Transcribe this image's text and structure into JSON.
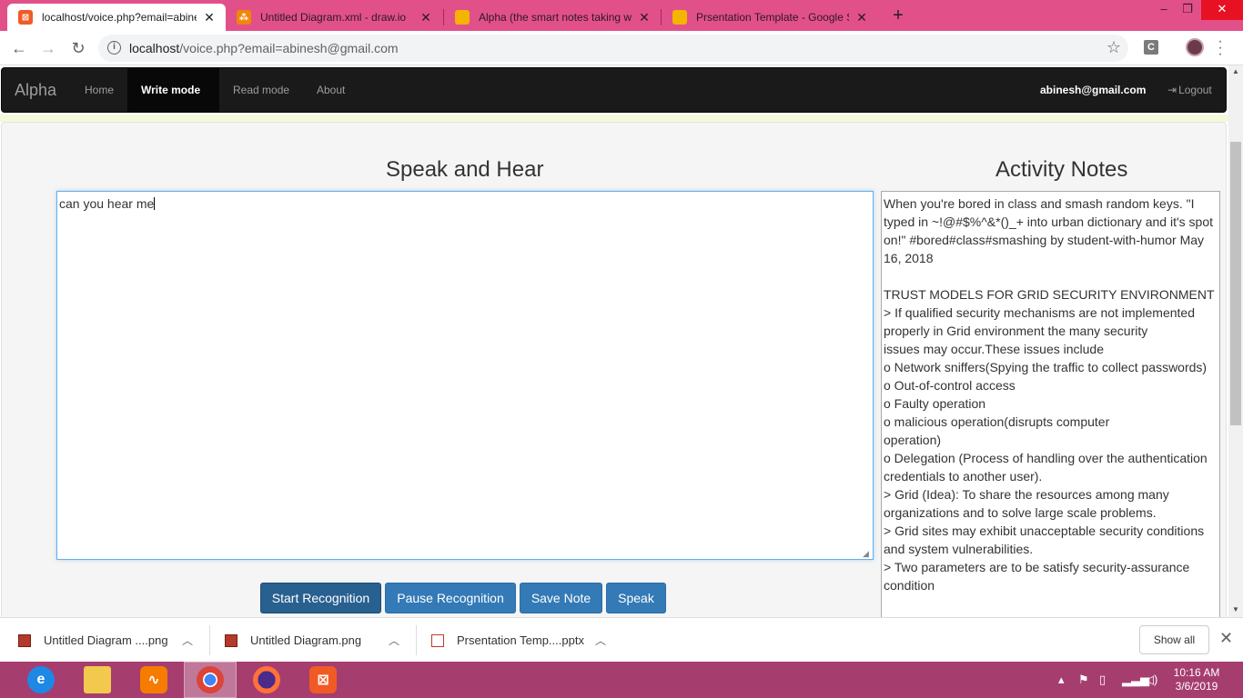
{
  "browser": {
    "tabs": [
      {
        "title": "localhost/voice.php?email=abinesh@gmail.com",
        "icon": "xampp-icon",
        "color": "#f15a24"
      },
      {
        "title": "Untitled Diagram.xml - draw.io",
        "icon": "drawio-icon",
        "color": "#f08705"
      },
      {
        "title": "Alpha (the smart notes taking web",
        "icon": "slides-icon",
        "color": "#f4b400"
      },
      {
        "title": "Prsentation Template - Google Sl",
        "icon": "slides-icon",
        "color": "#f4b400"
      }
    ],
    "new_tab": "+",
    "address": {
      "host": "localhost",
      "path": "/voice.php?email=abinesh@gmail.com"
    },
    "extension_label": "C",
    "window_controls": {
      "minimize": "–",
      "maximize": "❐",
      "close": "✕"
    }
  },
  "app": {
    "brand": "Alpha",
    "nav": [
      {
        "label": "Home"
      },
      {
        "label": "Write mode"
      },
      {
        "label": "Read mode"
      },
      {
        "label": "About"
      }
    ],
    "user_email": "abinesh@gmail.com",
    "logout_label": "Logout"
  },
  "speak": {
    "title": "Speak and Hear",
    "text": "can you hear me",
    "buttons": {
      "start": "Start Recognition",
      "pause": "Pause Recognition",
      "save": "Save Note",
      "speak": "Speak"
    }
  },
  "notes": {
    "title": "Activity Notes",
    "lines": [
      "When you're bored in class and smash random keys. \"I typed in ~!@#$%^&*()_+ into urban dictionary and it's spot on!\" #bored#class#smashing by student-with-humor May 16, 2018",
      "",
      "TRUST MODELS FOR GRID SECURITY ENVIRONMENT",
      "> If qualified security mechanisms are not implemented properly in Grid environment the many security",
      "issues may occur.These issues include",
      "o Network sniffers(Spying the traffic to collect passwords)",
      "o Out-of-control access",
      "o Faulty operation",
      "o malicious operation(disrupts computer",
      "operation)",
      "o Delegation (Process of handling over the authentication credentials to another user).",
      "> Grid (Idea): To share the resources among many organizations and to solve large scale problems.",
      "> Grid sites may exhibit unacceptable security conditions and system vulnerabilities.",
      "> Two parameters are to be satisfy security-assurance condition"
    ]
  },
  "downloads": {
    "items": [
      {
        "name": "Untitled Diagram ....png"
      },
      {
        "name": "Untitled Diagram.png"
      },
      {
        "name": "Prsentation Temp....pptx"
      }
    ],
    "show_all": "Show all"
  },
  "taskbar": {
    "time": "10:16 AM",
    "date": "3/6/2019"
  }
}
